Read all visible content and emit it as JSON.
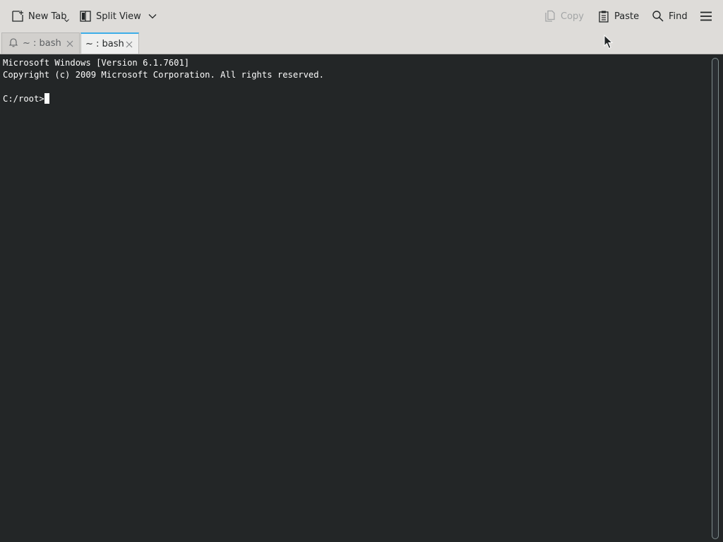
{
  "toolbar": {
    "new_tab_label": "New Tab",
    "split_view_label": "Split View",
    "copy_label": "Copy",
    "paste_label": "Paste",
    "find_label": "Find",
    "icons": {
      "new_tab": "new-tab-icon",
      "split_view": "split-view-icon",
      "copy": "copy-icon",
      "paste": "paste-icon",
      "find": "search-icon",
      "menu": "hamburger-menu-icon"
    }
  },
  "tabs": [
    {
      "title": "~ : bash",
      "active": false,
      "icon": "bell-icon"
    },
    {
      "title": "~ : bash",
      "active": true
    }
  ],
  "terminal": {
    "lines": [
      "Microsoft Windows [Version 6.1.7601]",
      "Copyright (c) 2009 Microsoft Corporation. All rights reserved."
    ],
    "prompt": "C:/root>"
  },
  "colors": {
    "toolbar_bg": "#dedcd9",
    "terminal_bg": "#232627",
    "terminal_fg": "#fcfcfc",
    "active_tab_accent": "#3daee9"
  }
}
